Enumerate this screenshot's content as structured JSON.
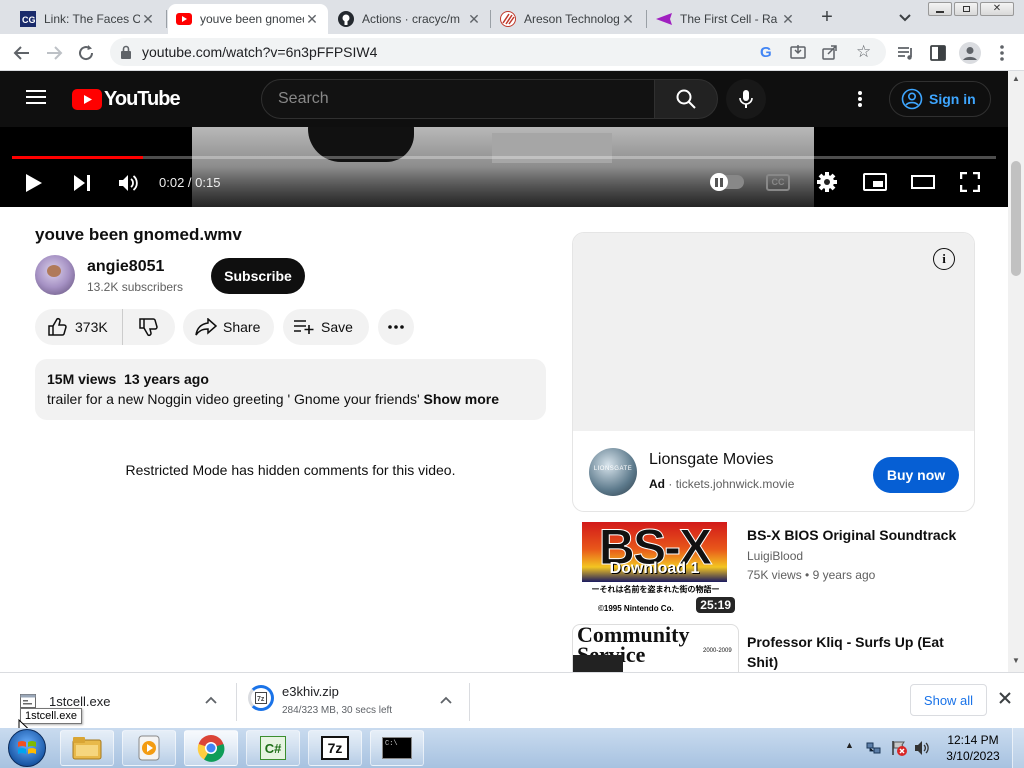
{
  "browser": {
    "tabs": [
      {
        "title": "Link: The Faces Of",
        "icon": "site-icon"
      },
      {
        "title": "youve been gnomed",
        "icon": "youtube-icon"
      },
      {
        "title": "Actions · cracyc/m",
        "icon": "github-icon"
      },
      {
        "title": "Areson Technology",
        "icon": "areson-icon"
      },
      {
        "title": "The First Cell - Ra",
        "icon": "firstcell-icon"
      }
    ],
    "url": "youtube.com/watch?v=6n3pFFPSIW4"
  },
  "youtube": {
    "logo_text": "YouTube",
    "search_placeholder": "Search",
    "sign_in": "Sign in",
    "player": {
      "time": "0:02 / 0:15",
      "progress": 0.133
    },
    "video": {
      "title": "youve been gnomed.wmv",
      "channel": "angie8051",
      "subscribers": "13.2K subscribers",
      "subscribe": "Subscribe",
      "likes": "373K",
      "share": "Share",
      "save": "Save",
      "views": "15M views",
      "age": "13 years ago",
      "description": "trailer for a new Noggin video greeting ' Gnome your friends'",
      "show_more": "Show more",
      "comments_notice": "Restricted Mode has hidden comments for this video."
    },
    "ad": {
      "advertiser": "Lionsgate Movies",
      "logo_text": "LIONSGATE",
      "badge": "Ad",
      "domain": "tickets.johnwick.movie",
      "cta": "Buy now"
    },
    "recommendations": [
      {
        "title": "BS-X BIOS Original Soundtrack",
        "channel": "LuigiBlood",
        "views": "75K views",
        "age": "9 years ago",
        "duration": "25:19",
        "thumb_big": "BS-X",
        "thumb_line1": "Download 1",
        "thumb_line2": "ーそれは名前を盗まれた街の物語ー",
        "thumb_line3": "©1995 Nintendo Co."
      },
      {
        "title": "Professor Kliq - Surfs Up (Eat Shit)",
        "thumb_big": "Community Service",
        "thumb_year": "2000-2009"
      }
    ]
  },
  "downloads": {
    "items": [
      {
        "name": "1stcell.exe",
        "status": ""
      },
      {
        "name": "e3khiv.zip",
        "status": "284/323 MB, 30 secs left"
      }
    ],
    "tooltip": "1stcell.exe",
    "show_all": "Show all"
  },
  "taskbar": {
    "apps": [
      "explorer-icon",
      "media-player-icon",
      "chrome-icon",
      "csharp-icon",
      "7zip-icon",
      "cmd-icon"
    ],
    "app_7zip_label": "7z",
    "app_cs_label": "C#",
    "app_cmd_label": "C:\\",
    "time": "12:14 PM",
    "date": "3/10/2023"
  }
}
